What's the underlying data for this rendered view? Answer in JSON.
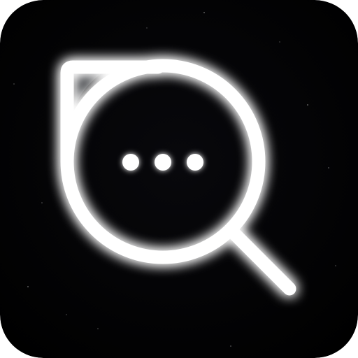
{
  "app": {
    "name": ""
  },
  "icon": {
    "symbol": "search-chat-icon",
    "background_color": "#020204",
    "foreground_color": "#ffffff",
    "accent_color": "#2b2d31",
    "glow_color": "#ffffff",
    "dots_count": 3
  }
}
